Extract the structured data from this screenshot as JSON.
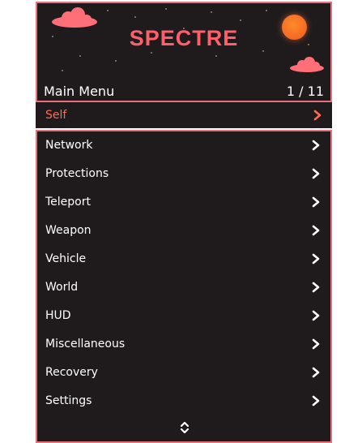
{
  "header": {
    "banner_title": "SPECTRE",
    "menu_title": "Main Menu",
    "page_counter": "1 / 11"
  },
  "selected_item": {
    "label": "Self",
    "icon": "chevron-right-icon"
  },
  "items": [
    {
      "label": "Network",
      "icon": "chevron-right-icon"
    },
    {
      "label": "Protections",
      "icon": "chevron-right-icon"
    },
    {
      "label": "Teleport",
      "icon": "chevron-right-icon"
    },
    {
      "label": "Weapon",
      "icon": "chevron-right-icon"
    },
    {
      "label": "Vehicle",
      "icon": "chevron-right-icon"
    },
    {
      "label": "World",
      "icon": "chevron-right-icon"
    },
    {
      "label": "HUD",
      "icon": "chevron-right-icon"
    },
    {
      "label": "Miscellaneous",
      "icon": "chevron-right-icon"
    },
    {
      "label": "Recovery",
      "icon": "chevron-right-icon"
    },
    {
      "label": "Settings",
      "icon": "chevron-right-icon"
    }
  ],
  "footer": {
    "scroll_icon": "up-down-arrows-icon"
  },
  "colors": {
    "accent": "#e8707b",
    "title": "#ff5f6a",
    "selected_text": "#ff6a52",
    "background": "#1f1b1d",
    "sun": "#f05a20"
  }
}
